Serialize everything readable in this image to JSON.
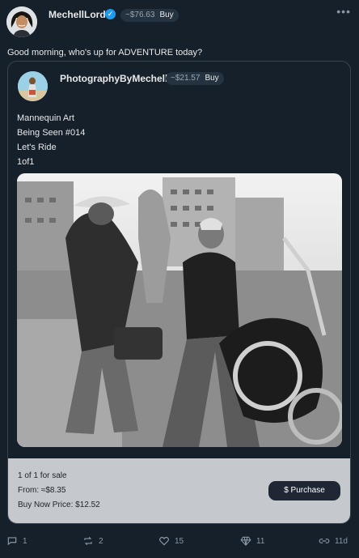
{
  "post": {
    "author": "MechellLord",
    "price_pill": "~$76.63",
    "buy_label": "Buy",
    "more_label": "•••",
    "text": "Good morning, who's up for ADVENTURE today?"
  },
  "quote": {
    "author": "PhotographyByMechell",
    "price_pill": "~$21.57",
    "buy_label": "Buy",
    "lines": [
      "Mannequin Art",
      "Being Seen #014",
      "Let's Ride",
      "1of1"
    ],
    "sale": {
      "count": "1 of 1 for sale",
      "from": "From: ≈$8.35",
      "buy_now": "Buy Now Price: $12.52",
      "purchase_label": "Purchase",
      "purchase_symbol": "$"
    }
  },
  "actions": {
    "reply_count": "1",
    "repost_count": "2",
    "like_count": "15",
    "diamond_count": "11",
    "age": "11d"
  },
  "colors": {
    "background": "#15202b",
    "verified": "#1d9bf0",
    "sale_panel": "#c5c8cc"
  }
}
